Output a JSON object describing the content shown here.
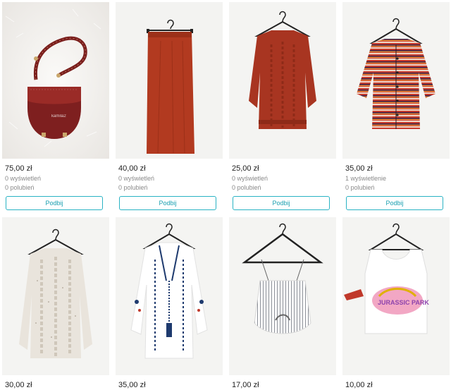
{
  "listings": [
    {
      "price": "75,00 zł",
      "views": "0 wyświetleń",
      "likes": "0 polubień",
      "button": "Podbij",
      "image_text": "kamila2"
    },
    {
      "price": "40,00 zł",
      "views": "0 wyświetleń",
      "likes": "0 polubień",
      "button": "Podbij"
    },
    {
      "price": "25,00 zł",
      "views": "0 wyświetleń",
      "likes": "0 polubień",
      "button": "Podbij"
    },
    {
      "price": "35,00 zł",
      "views": "1 wyświetlenie",
      "likes": "0 polubień",
      "button": "Podbij"
    },
    {
      "price": "30,00 zł"
    },
    {
      "price": "35,00 zł"
    },
    {
      "price": "17,00 zł"
    },
    {
      "price": "10,00 zł",
      "image_text": "JURASSIC PARK"
    }
  ]
}
